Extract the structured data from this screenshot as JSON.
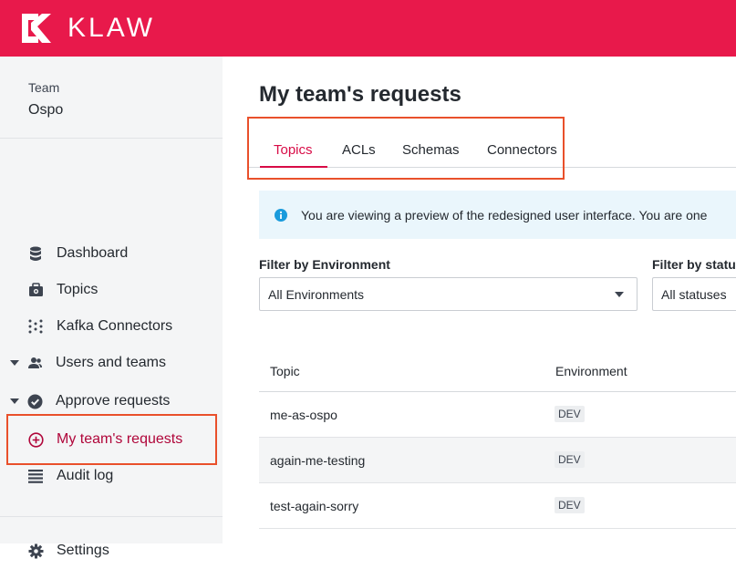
{
  "header": {
    "brand": "KLAW",
    "accent": "#e8194b"
  },
  "sidebar": {
    "team_label": "Team",
    "team_name": "Ospo",
    "items": [
      {
        "label": "Dashboard",
        "icon": "database-icon"
      },
      {
        "label": "Topics",
        "icon": "topics-icon"
      },
      {
        "label": "Kafka Connectors",
        "icon": "connectors-icon"
      },
      {
        "label": "Users and teams",
        "icon": "users-icon",
        "expandable": true
      },
      {
        "label": "Approve requests",
        "icon": "check-circle-icon",
        "expandable": true
      },
      {
        "label": "My team's requests",
        "icon": "plus-circle-icon",
        "active": true
      },
      {
        "label": "Audit log",
        "icon": "list-icon"
      },
      {
        "label": "Settings",
        "icon": "gear-icon"
      }
    ]
  },
  "main": {
    "title": "My team's requests",
    "tabs": [
      {
        "label": "Topics",
        "active": true
      },
      {
        "label": "ACLs"
      },
      {
        "label": "Schemas"
      },
      {
        "label": "Connectors"
      }
    ],
    "banner": "You are viewing a preview of the redesigned user interface. You are one",
    "filters": {
      "environment": {
        "label": "Filter by Environment",
        "value": "All Environments"
      },
      "status": {
        "label": "Filter by status",
        "value": "All statuses"
      }
    },
    "table": {
      "columns": [
        "Topic",
        "Environment"
      ],
      "rows": [
        {
          "topic": "me-as-ospo",
          "environment": "DEV"
        },
        {
          "topic": "again-me-testing",
          "environment": "DEV"
        },
        {
          "topic": "test-again-sorry",
          "environment": "DEV"
        }
      ]
    }
  }
}
